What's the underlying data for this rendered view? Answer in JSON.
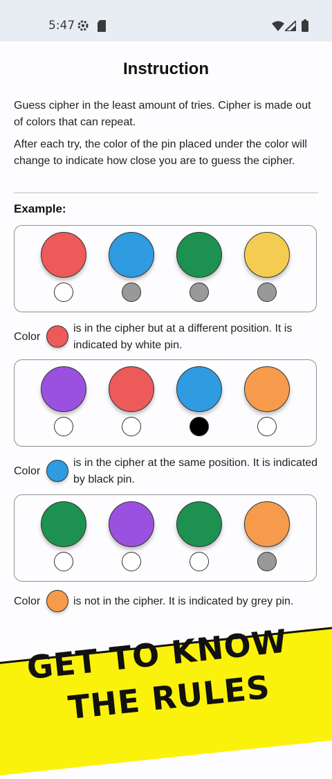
{
  "status": {
    "time": "5:47"
  },
  "title": "Instruction",
  "intro": {
    "p1": "Guess cipher in the least amount of tries. Cipher is made out of colors that can repeat.",
    "p2": "After each try, the color of the pin placed under the color will change to indicate how close you are to guess the cipher."
  },
  "example_label": "Example:",
  "colors": {
    "red": "#ec5a5a",
    "blue": "#2f9be0",
    "green": "#1d9150",
    "yellow": "#f5cc52",
    "purple": "#9b51e0",
    "orange": "#f59b4b",
    "pin_white": "#ffffff",
    "pin_grey": "#999999",
    "pin_black": "#000000",
    "banner": "#fbf20b"
  },
  "examples": [
    {
      "balls": [
        "red",
        "blue",
        "green",
        "yellow"
      ],
      "pins": [
        "pin_white",
        "pin_grey",
        "pin_grey",
        "pin_grey"
      ],
      "color_word": "Color",
      "dot": "red",
      "text": "is in the cipher but at a different position. It is indicated by white pin."
    },
    {
      "balls": [
        "purple",
        "red",
        "blue",
        "orange"
      ],
      "pins": [
        "pin_white",
        "pin_white",
        "pin_black",
        "pin_white"
      ],
      "color_word": "Color",
      "dot": "blue",
      "text": "is in the cipher at the same position. It is indicated by black pin."
    },
    {
      "balls": [
        "green",
        "purple",
        "green",
        "orange"
      ],
      "pins": [
        "pin_white",
        "pin_white",
        "pin_white",
        "pin_grey"
      ],
      "color_word": "Color",
      "dot": "orange",
      "text": "is not in the cipher. It is indicated by grey pin."
    }
  ],
  "banner": {
    "line1": "GET TO KNOW",
    "line2": "THE RULES"
  }
}
